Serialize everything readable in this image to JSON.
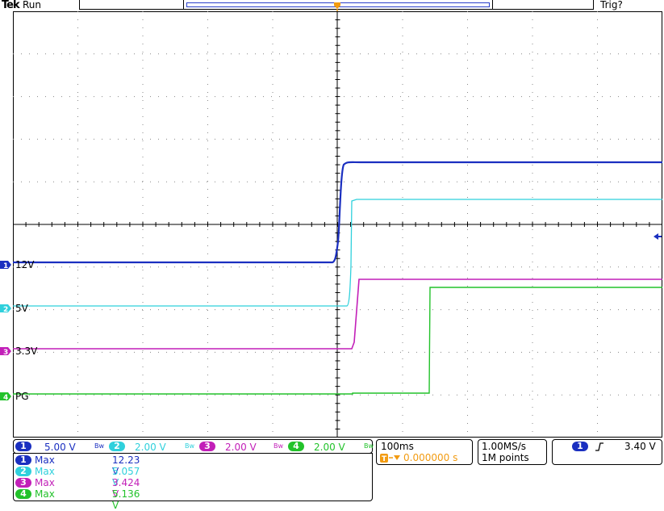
{
  "header": {
    "brand": "Tek",
    "status": "Run",
    "trigger_status": "Trig?",
    "trigger_marker": "T"
  },
  "channels": [
    {
      "id": "1",
      "label": "12V",
      "color": "#1a2fc0",
      "scale": "5.00 V",
      "bw": "Bw",
      "meas_label": "Max",
      "meas_value": "12.23 V"
    },
    {
      "id": "2",
      "label": "5V",
      "color": "#2fd0dc",
      "scale": "2.00 V",
      "bw": "Bw",
      "meas_label": "Max",
      "meas_value": "5.057 V"
    },
    {
      "id": "3",
      "label": "3.3V",
      "color": "#c21fb8",
      "scale": "2.00 V",
      "bw": "Bw",
      "meas_label": "Max",
      "meas_value": "3.424 V"
    },
    {
      "id": "4",
      "label": "PG",
      "color": "#22c22a",
      "scale": "2.00 V",
      "bw": "Bw",
      "meas_label": "Max",
      "meas_value": "5.136 V"
    }
  ],
  "timebase": {
    "time_div": "100ms",
    "delay": "0.000000 s",
    "sample_rate": "1.00MS/s",
    "record_length": "1M points"
  },
  "trigger": {
    "source": "1",
    "slope_icon": "rising-edge-icon",
    "level": "3.40 V"
  },
  "colors": {
    "trigger_orange": "#f29b11",
    "grid": "#888888"
  }
}
